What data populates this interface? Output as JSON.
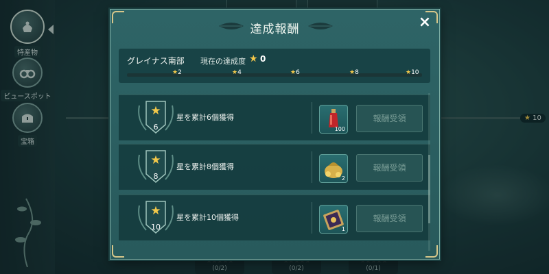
{
  "sidebar": {
    "items": [
      {
        "label": "特産物",
        "icon": "acorn-pot-icon"
      },
      {
        "label": "ビュースポット",
        "icon": "binoculars-icon"
      },
      {
        "label": "宝箱",
        "icon": "treasure-chest-icon"
      }
    ]
  },
  "background": {
    "star_tag": "10",
    "bottom_counts": [
      "(0/2)",
      "(0/2)",
      "(0/1)"
    ]
  },
  "modal": {
    "title": "達成報酬",
    "close_icon": "×",
    "area_name": "グレイナス南部",
    "rate_label": "現在の達成度",
    "rate_value": "0",
    "milestones": [
      "2",
      "4",
      "6",
      "8",
      "10"
    ],
    "rewards": [
      {
        "level": "6",
        "text": "星を累計6個獲得",
        "item_icon": "red-potion-icon",
        "item_count": "100",
        "claim_label": "報酬受領"
      },
      {
        "level": "8",
        "text": "星を累計8個獲得",
        "item_icon": "gold-coin-bag-icon",
        "item_count": "2",
        "claim_label": "報酬受領"
      },
      {
        "level": "10",
        "text": "星を累計10個獲得",
        "item_icon": "magic-scroll-icon",
        "item_count": "1",
        "claim_label": "報酬受領"
      }
    ]
  },
  "colors": {
    "accent_gold": "#f3c84a",
    "modal_bg": "#2e6466",
    "disabled_button_text": "#7c9f98"
  }
}
